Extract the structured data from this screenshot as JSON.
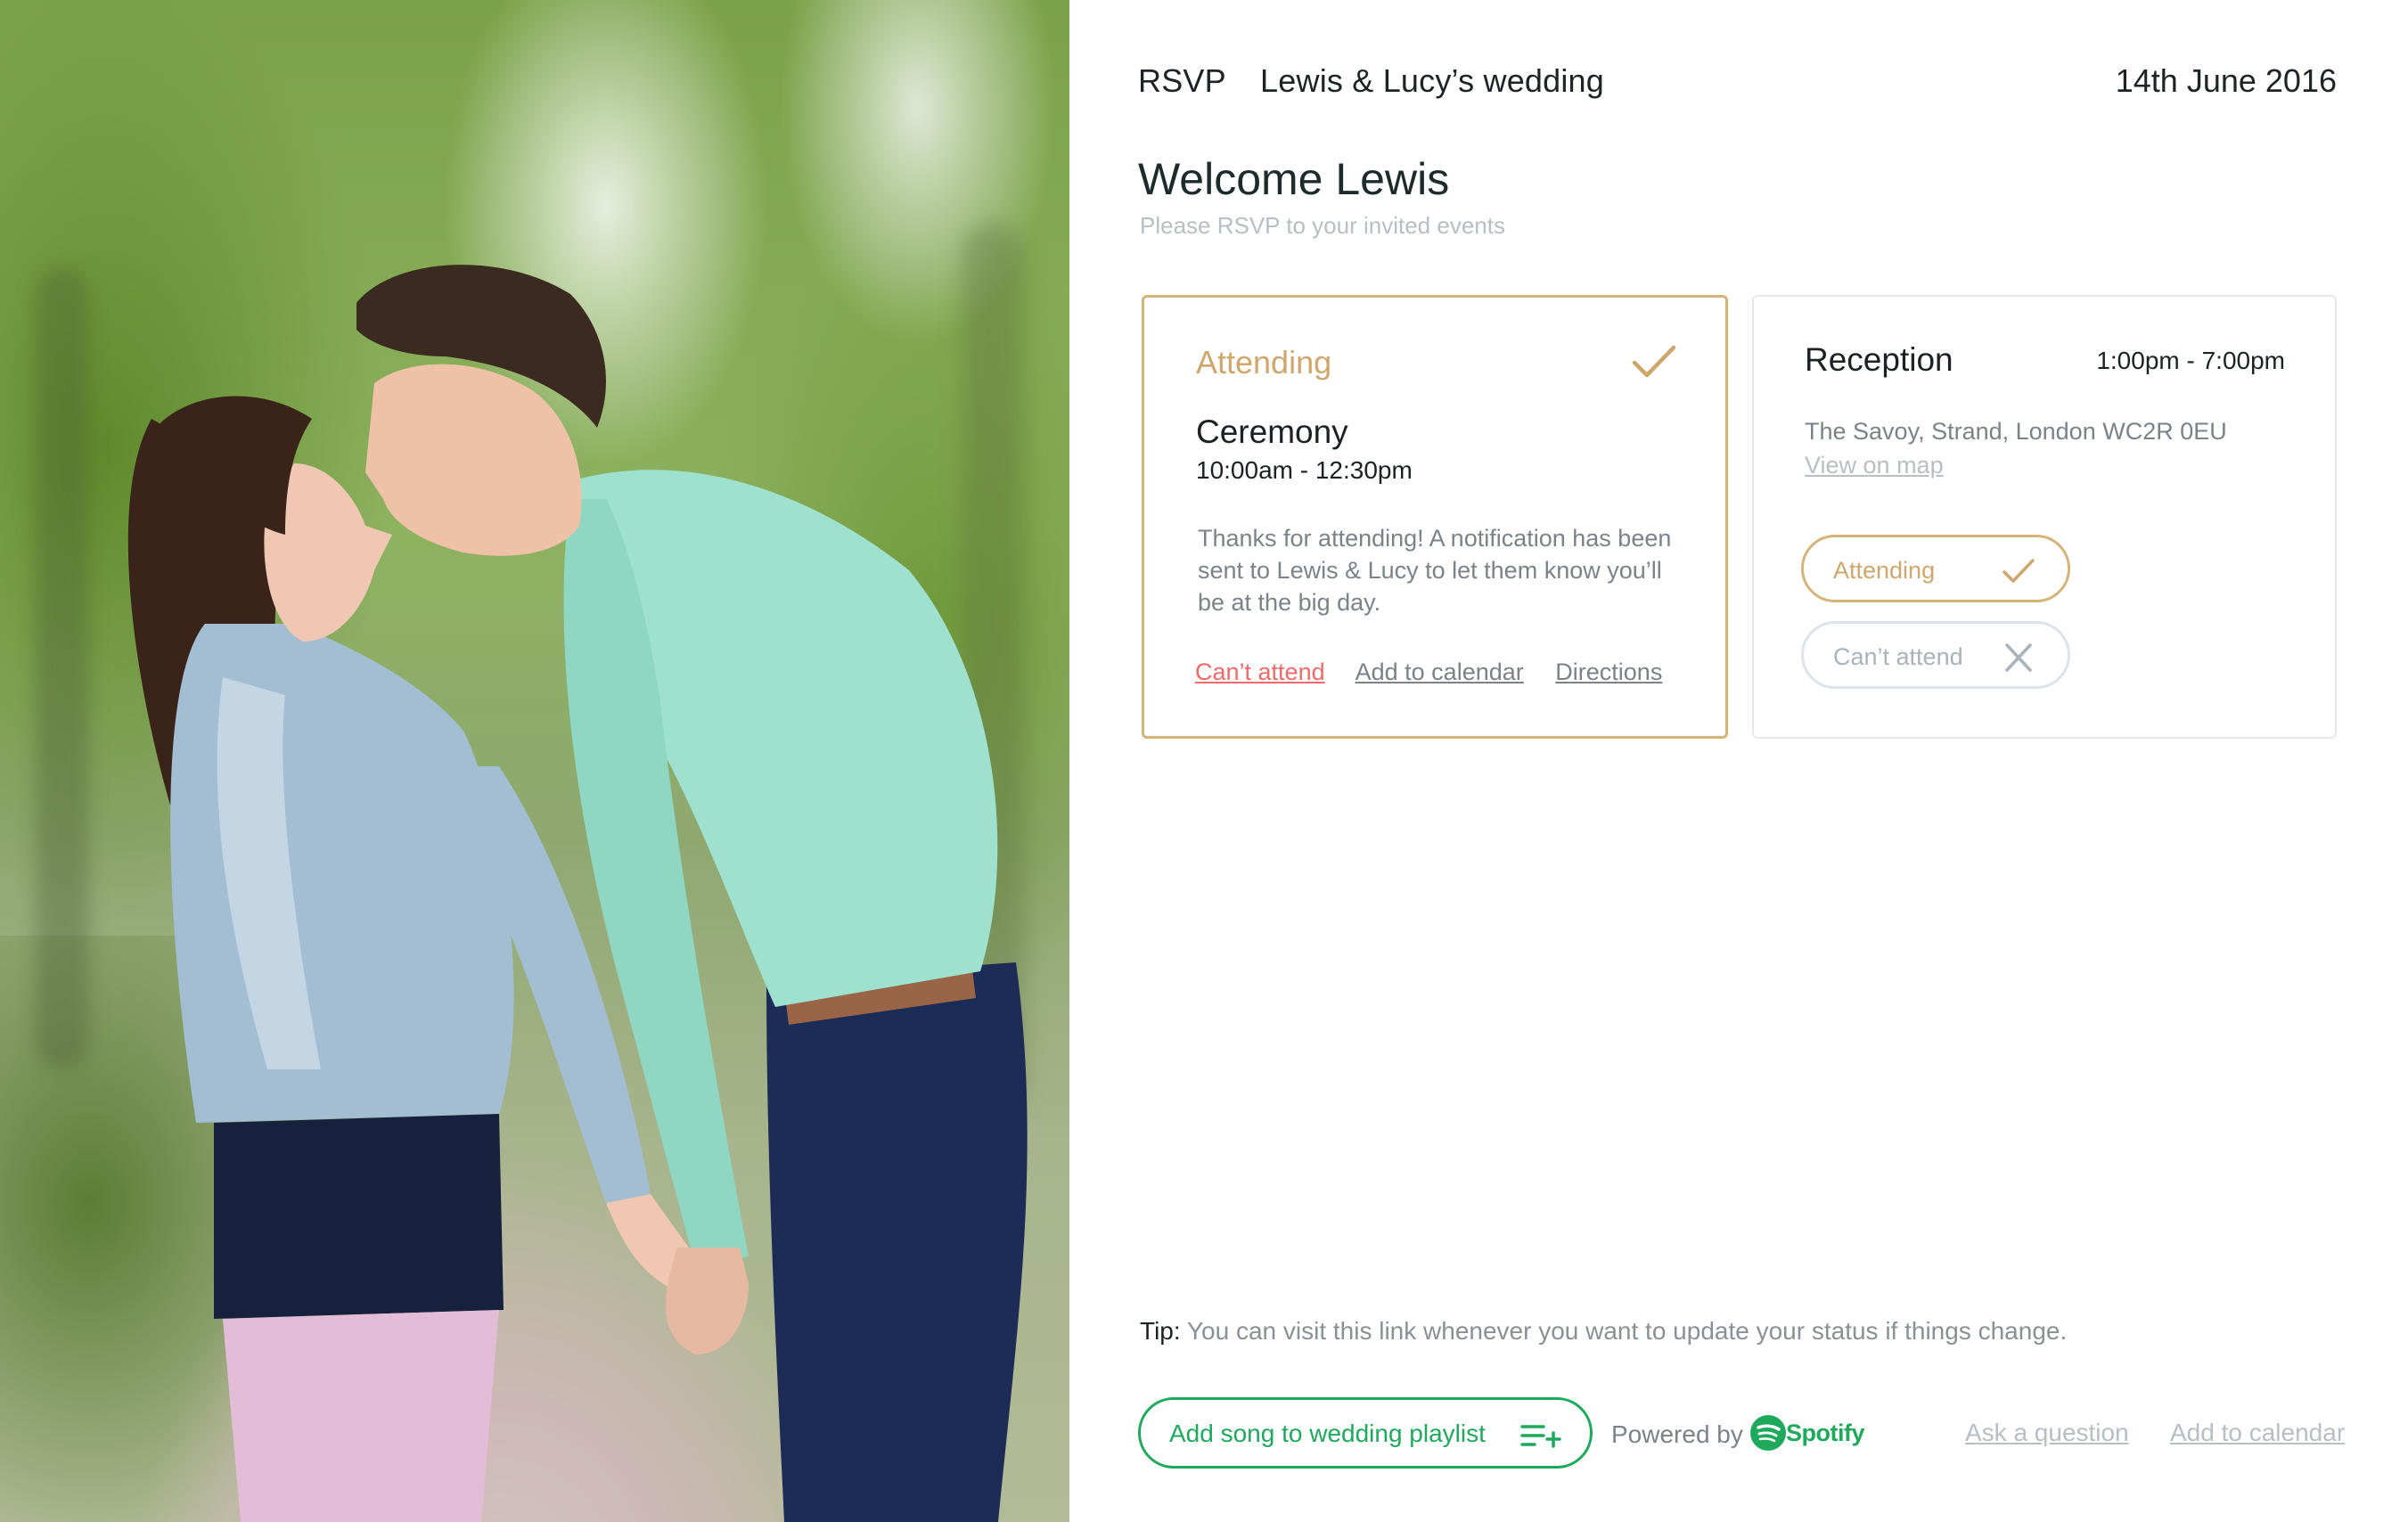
{
  "header": {
    "rsvp_label": "RSVP",
    "event_title": "Lewis & Lucy’s wedding",
    "date": "14th June 2016"
  },
  "welcome": {
    "title": "Welcome Lewis",
    "subtitle": "Please RSVP to your invited events"
  },
  "ceremony": {
    "status": "Attending",
    "title": "Ceremony",
    "time": "10:00am - 12:30pm",
    "message": "Thanks for attending! A notification has been sent to Lewis & Lucy to let them know you’ll be at the big day.",
    "links": {
      "cant_attend": "Can’t attend",
      "add_to_calendar": "Add to calendar",
      "directions": "Directions"
    }
  },
  "reception": {
    "title": "Reception",
    "time": "1:00pm - 7:00pm",
    "address": "The Savoy, Strand, London WC2R 0EU",
    "map_link": "View on map",
    "attending_button": "Attending",
    "cant_attend_button": "Can’t attend"
  },
  "tip": {
    "label": "Tip:",
    "text": "You can visit this link whenever you want to update your status if things change."
  },
  "footer": {
    "playlist_button": "Add song to wedding playlist",
    "powered_by": "Powered by",
    "spotify": "Spotify",
    "ask_question": "Ask a question",
    "add_to_calendar": "Add to calendar"
  },
  "colors": {
    "gold": "#d5b479",
    "green": "#1fa95d",
    "red": "#ef6a6a",
    "muted": "#b8bec4"
  },
  "icons": [
    "check-icon",
    "close-icon",
    "playlist-add-icon",
    "spotify-logo"
  ]
}
